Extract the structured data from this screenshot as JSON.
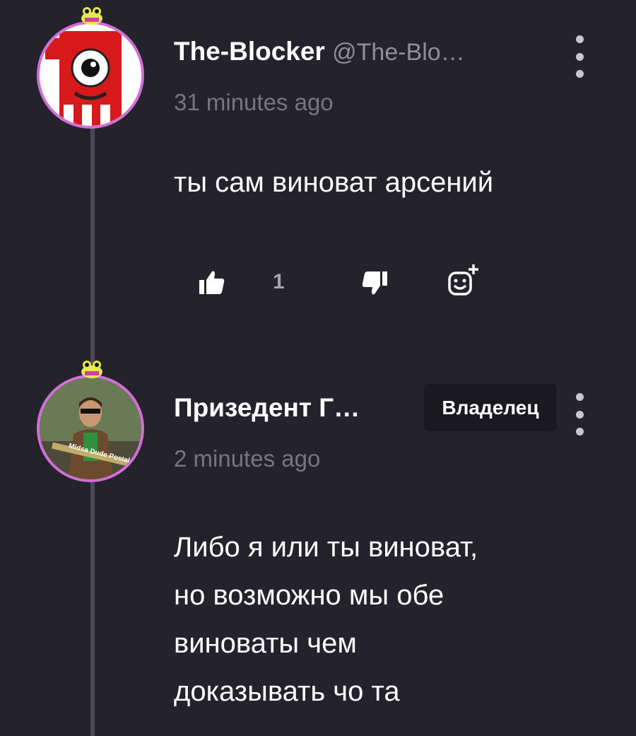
{
  "comments": [
    {
      "username": "The-Blocker",
      "handle": "@The-Blo…",
      "time": "31 minutes ago",
      "text": "ты сам виноват арсений",
      "likes": "1"
    },
    {
      "username": "Призедент Г…",
      "badge": "Владелец",
      "time": "2 minutes ago",
      "text_lines": [
        "Либо я или ты виноват,",
        "но возможно мы обе",
        "виноваты чем",
        "доказывать чо та"
      ],
      "avatar_caption": "Midsa Dude Postal"
    }
  ],
  "icons": {
    "like": "thumbs-up-icon",
    "dislike": "thumbs-down-icon",
    "react": "add-reaction-icon",
    "more": "more-vertical-icon"
  },
  "colors": {
    "background": "#24232c",
    "avatar_ring": "#d16fd6",
    "muted_text": "#77767f"
  }
}
